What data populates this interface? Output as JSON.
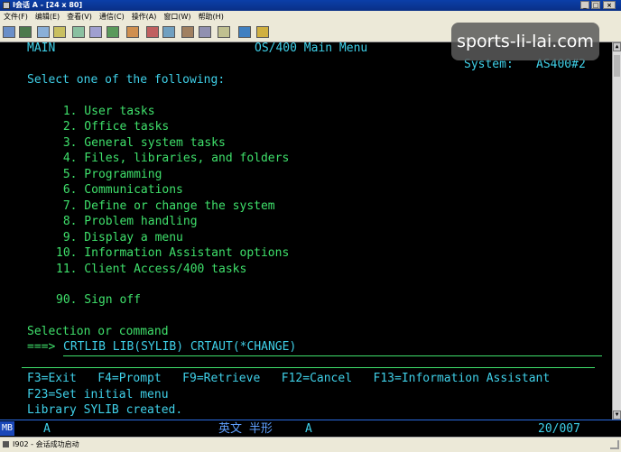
{
  "window": {
    "title": "I会话 A - [24 x 80]",
    "controls": [
      "_",
      "□",
      "×"
    ]
  },
  "menubar": [
    "文件(F)",
    "编辑(E)",
    "查看(V)",
    "通信(C)",
    "操作(A)",
    "窗口(W)",
    "帮助(H)"
  ],
  "watermark": "sports-li-lai.com",
  "screen": {
    "main_label": "MAIN",
    "title": "OS/400 Main Menu",
    "system_label": "System:",
    "system_name": "AS400#2",
    "prompt": "Select one of the following:",
    "options": [
      " 1. User tasks",
      " 2. Office tasks",
      " 3. General system tasks",
      " 4. Files, libraries, and folders",
      " 5. Programming",
      " 6. Communications",
      " 7. Define or change the system",
      " 8. Problem handling",
      " 9. Display a menu",
      "10. Information Assistant options",
      "11. Client Access/400 tasks"
    ],
    "signoff": "90. Sign off",
    "selection_label": "Selection or command",
    "arrow": "===>",
    "command": "CRTLIB LIB(SYLIB) CRTAUT(*CHANGE)",
    "fkeys_line1": "F3=Exit   F4=Prompt   F9=Retrieve   F12=Cancel   F13=Information Assistant",
    "fkeys_line2": "F23=Set initial menu",
    "message": "Library SYLIB created."
  },
  "oia": {
    "mark": "MB",
    "a1": "A",
    "ime": "英文 半形",
    "a2": "A",
    "cursor": "20/007"
  },
  "statusbar": {
    "text": "I902 - 会话成功启动"
  }
}
